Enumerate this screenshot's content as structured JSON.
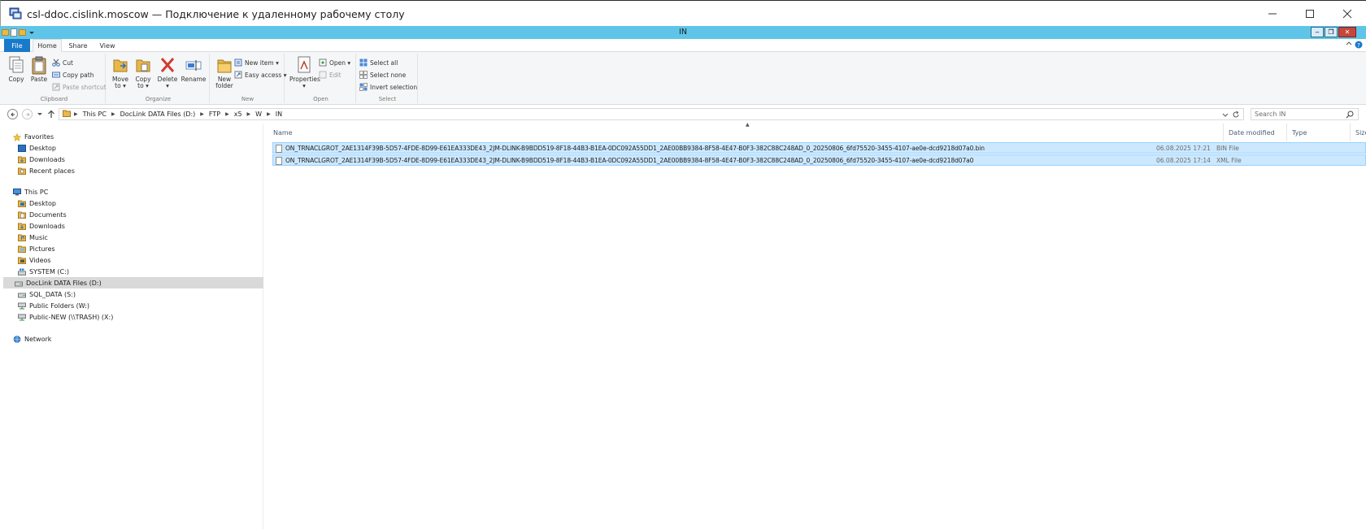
{
  "rdp_window": {
    "title": "csl-ddoc.cislink.moscow — Подключение к удаленному рабочему столу",
    "controls": {
      "minimize": "─",
      "maximize": "☐",
      "close": "✕"
    }
  },
  "explorer_window": {
    "title": "IN",
    "controls": {
      "minimize": "‒",
      "restore": "❐",
      "close": "✕"
    }
  },
  "ribbon_tabs": [
    "File",
    "Home",
    "Share",
    "View"
  ],
  "ribbon": {
    "clipboard": {
      "label": "Clipboard",
      "copy": "Copy",
      "paste": "Paste",
      "cut": "Cut",
      "copy_path": "Copy path",
      "paste_shortcut": "Paste shortcut"
    },
    "organize": {
      "label": "Organize",
      "move_to_1": "Move",
      "move_to_2": "to ▾",
      "copy_to_1": "Copy",
      "copy_to_2": "to ▾",
      "delete_1": "Delete",
      "delete_2": "▾",
      "rename": "Rename"
    },
    "new": {
      "label": "New",
      "new_folder_1": "New",
      "new_folder_2": "folder",
      "new_item": "New item ▾",
      "easy_access": "Easy access ▾"
    },
    "open": {
      "label": "Open",
      "properties": "Properties",
      "properties_arrow": "▾",
      "open": "Open ▾",
      "edit": "Edit"
    },
    "select": {
      "label": "Select",
      "select_all": "Select all",
      "select_none": "Select none",
      "invert_selection": "Invert selection"
    }
  },
  "address_bar": {
    "breadcrumbs": [
      "This PC",
      "DocLink DATA Files (D:)",
      "FTP",
      "x5",
      "W",
      "IN"
    ],
    "search_placeholder": "Search IN"
  },
  "nav_pane": {
    "favorites": "Favorites",
    "favorites_items": [
      "Desktop",
      "Downloads",
      "Recent places"
    ],
    "this_pc": "This PC",
    "this_pc_items": [
      "Desktop",
      "Documents",
      "Downloads",
      "Music",
      "Pictures",
      "Videos",
      "SYSTEM (C:)",
      "DocLink DATA Files (D:)",
      "SQL_DATA (S:)",
      "Public Folders (W:)",
      "Public-NEW (\\\\TRASH) (X:)"
    ],
    "network": "Network",
    "selected": "DocLink DATA Files (D:)"
  },
  "file_list": {
    "columns": {
      "name": "Name",
      "date": "Date modified",
      "type": "Type",
      "size": "Size"
    },
    "files": [
      {
        "name": "ON_TRNACLGROT_2AE1314F39B-5D57-4FDE-8D99-E61EA333DE43_2JM-DLINK-B9BDD519-8F18-44B3-B1EA-0DC092A55DD1_2AE00BB9384-8F58-4E47-B0F3-382C88C248AD_0_20250806_6fd75520-3455-4107-ae0e-dcd9218d07a0.bin",
        "date": "06.08.2025 17:21",
        "type": "BIN File"
      },
      {
        "name": "ON_TRNACLGROT_2AE1314F39B-5D57-4FDE-8D99-E61EA333DE43_2JM-DLINK-B9BDD519-8F18-44B3-B1EA-0DC092A55DD1_2AE00BB9384-8F58-4E47-B0F3-382C88C248AD_0_20250806_6fd75520-3455-4107-ae0e-dcd9218d07a0",
        "date": "06.08.2025 17:14",
        "type": "XML File"
      }
    ]
  },
  "colors": {
    "explorer_titlebar": "#5ec5e8",
    "file_tab": "#1979ca",
    "selection": "#cce8ff",
    "folder": "#e8b84a"
  }
}
